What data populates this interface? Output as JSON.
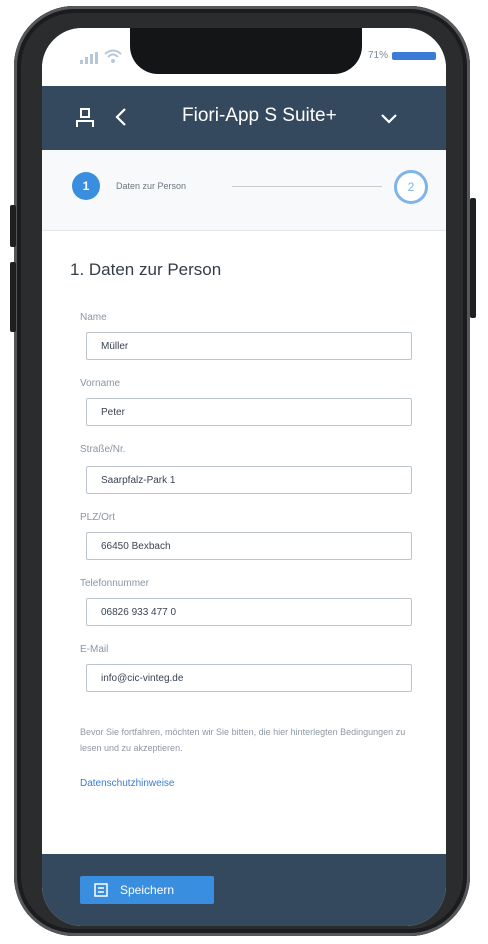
{
  "status_bar": {
    "battery_percent": "71%",
    "signal_icon": "signal-icon",
    "wifi_icon": "wifi-icon",
    "battery_icon": "battery-icon"
  },
  "header": {
    "title": "Fiori-App S Suite+",
    "user_icon": "user-icon",
    "back_icon": "back-icon",
    "menu_icon": "chevron-down-icon"
  },
  "stepper": {
    "step1_number": "1",
    "step1_label": "Daten zur Person",
    "step2_number": "2"
  },
  "form": {
    "section_title": "1. Daten zur Person",
    "fields": [
      {
        "label": "Name",
        "value": "Müller"
      },
      {
        "label": "Vorname",
        "value": "Peter"
      },
      {
        "label": "Straße/Nr.",
        "value": "Saarpfalz-Park 1"
      },
      {
        "label": "PLZ/Ort",
        "value": "66450 Bexbach"
      },
      {
        "label": "Telefonnummer",
        "value": "06826 933 477 0"
      },
      {
        "label": "E-Mail",
        "value": "info@cic-vinteg.de"
      }
    ],
    "consent_text": "Bevor Sie fortfahren, möchten wir Sie bitten, die hier hinterlegten Bedingungen zu lesen und zu akzeptieren.",
    "privacy_link": "Datenschutzhinweise"
  },
  "footer": {
    "save_label": "Speichern",
    "save_icon": "save-icon"
  },
  "colors": {
    "header_bg": "#35495e",
    "accent": "#3a8ee0",
    "link": "#3a7bd5"
  }
}
